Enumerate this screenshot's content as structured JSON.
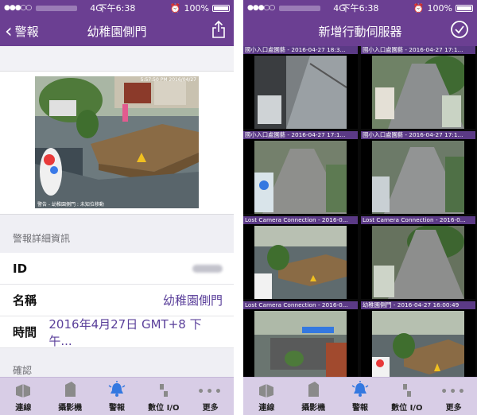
{
  "status": {
    "network": "4G",
    "time": "下午6:38",
    "battery": "100%"
  },
  "left": {
    "nav": {
      "back_label": "警報",
      "title": "幼稚園側門"
    },
    "snapshot": {
      "timestamp": "5:57:50 PM 2016/04/27",
      "caption": "警告 - 幼稚園側門 : 未知位移動"
    },
    "detail_header": "警報詳細資訊",
    "rows": [
      {
        "key": "ID",
        "value": ""
      },
      {
        "key": "名稱",
        "value": "幼稚園側門"
      },
      {
        "key": "時間",
        "value": "2016年4月27日 GMT+8 下午..."
      }
    ],
    "confirm_header": "確認"
  },
  "right": {
    "nav": {
      "title": "新增行動伺服器"
    },
    "tiles": [
      {
        "label": "國小入口處園藝 - 2016-04-27 18:3..."
      },
      {
        "label": "國小入口處園藝 - 2016-04-27 17:1..."
      },
      {
        "label": "國小入口處園藝 - 2016-04-27 17:1..."
      },
      {
        "label": "國小入口處園藝 - 2016-04-27 17:1..."
      },
      {
        "label": "Lost Camera Connection - 2016-0..."
      },
      {
        "label": "Lost Camera Connection - 2016-0..."
      },
      {
        "label": "Lost Camera Connection - 2016-0..."
      },
      {
        "label": "幼稚園側門 - 2016-04-27 16:00:49"
      }
    ]
  },
  "tabs": [
    {
      "label": "連線",
      "icon": "connection-icon"
    },
    {
      "label": "攝影機",
      "icon": "camera-icon"
    },
    {
      "label": "警報",
      "icon": "alarm-bell-icon"
    },
    {
      "label": "數位 I/O",
      "icon": "digital-io-icon"
    },
    {
      "label": "更多",
      "icon": "more-icon"
    }
  ],
  "colors": {
    "brand": "#6b3f92",
    "tab_bar": "#d8cde6",
    "link": "#5a3f9a"
  }
}
